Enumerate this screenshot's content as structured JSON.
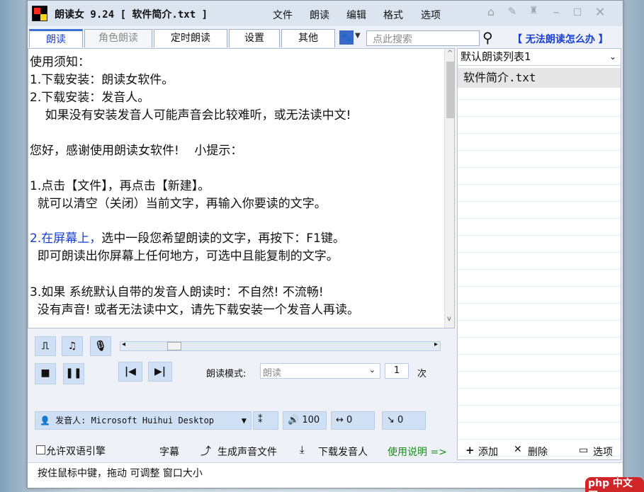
{
  "window": {
    "title": "朗读女 9.24 [ 软件简介.txt ]",
    "menu": [
      "文件",
      "朗读",
      "编辑",
      "格式",
      "选项"
    ],
    "controls": [
      "pin-icon",
      "pen-icon",
      "shirt-icon",
      "minimize-icon",
      "maximize-icon",
      "close-icon"
    ]
  },
  "tabs": [
    "朗读",
    "角色朗读",
    "定时朗读",
    "设置",
    "其他"
  ],
  "search": {
    "placeholder": "点此搜索",
    "help_link": "【 无法朗读怎么办 】"
  },
  "editor": {
    "lines": [
      "使用须知：",
      "1.下载安装：朗读女软件。",
      "2.下载安装：发音人。",
      "    如果没有安装发音人可能声音会比较难听，或无法读中文!",
      "",
      "您好，感谢使用朗读女软件!    小提示：",
      "",
      "1.点击【文件】，再点击【新建】。",
      "  就可以清空（关闭）当前文字，再输入你要读的文字。",
      "",
      "2.在屏幕上，选中一段您希望朗读的文字，再按下：F1键。",
      "  即可朗读出你屏幕上任何地方，可选中且能复制的文字。",
      "",
      "3.如果 系统默认自带的发音人朗读时：不自然! 不流畅!",
      "  没有声音! 或者无法读中文，请先下载安装一个发音人再读。"
    ],
    "highlight_prefix": "2.在屏幕上，",
    "highlight_rest": "选中一段您希望朗读的文字，再按下：F1键。"
  },
  "player": {
    "mode_label": "朗读模式:",
    "mode_value": "朗读",
    "repeat_value": "1",
    "repeat_unit": "次",
    "progress": 0.0
  },
  "voice": {
    "label": "发音人: Microsoft Huihui Desktop",
    "volume": "100",
    "speed": "0",
    "pitch": "0"
  },
  "bottom": {
    "bilingual": "允许双语引擎",
    "subtitle": "字幕",
    "generate": "生成声音文件",
    "download": "下载发音人",
    "manual": "使用说明 =>"
  },
  "playlist": {
    "selected": "默认朗读列表1",
    "items": [
      "软件简介.txt"
    ],
    "add": "添加",
    "delete": "删除",
    "options": "选项"
  },
  "status": "按住鼠标中键，拖动 可调整 窗口大小",
  "watermark": "php 中文网",
  "colors": {
    "accent": "#1a3fcf",
    "manual": "#1e8a1e",
    "button": "#cfe0f5"
  }
}
